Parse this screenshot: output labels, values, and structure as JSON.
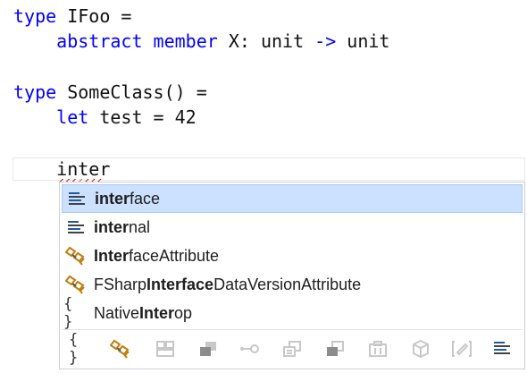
{
  "code": {
    "line1": {
      "kw": "type",
      "rest": " IFoo ="
    },
    "line2": {
      "indent": "    ",
      "kw1": "abstract",
      "sp1": " ",
      "kw2": "member",
      "mid": " X: unit ",
      "arrow": "->",
      "end": " unit"
    },
    "line4": {
      "kw": "type",
      "rest": " SomeClass() ="
    },
    "line5": {
      "indent": "    ",
      "kw": "let",
      "rest": " test = 42"
    },
    "line7": {
      "indent": "    ",
      "text": "inter"
    }
  },
  "completion": {
    "items": [
      {
        "bold": "inter",
        "rest": "face",
        "pre": "",
        "icon": "keyword-icon",
        "selected": true
      },
      {
        "bold": "inter",
        "rest": "nal",
        "pre": "",
        "icon": "keyword-icon",
        "selected": false
      },
      {
        "bold": "Inter",
        "rest": "faceAttribute",
        "pre": "",
        "icon": "class-icon",
        "selected": false
      },
      {
        "bold": "Interface",
        "rest": "DataVersionAttribute",
        "pre": "FSharp",
        "icon": "class-icon",
        "selected": false
      },
      {
        "bold": "Inter",
        "rest": "op",
        "pre": "Native",
        "icon": "namespace-icon",
        "selected": false
      }
    ],
    "filters": [
      {
        "name": "namespace-filter-icon",
        "glyph": "{ }"
      },
      {
        "name": "class-filter-icon",
        "glyph": ""
      },
      {
        "name": "structure-filter-icon",
        "glyph": ""
      },
      {
        "name": "module-filter-icon",
        "glyph": ""
      },
      {
        "name": "interface-filter-icon",
        "glyph": ""
      },
      {
        "name": "enum-filter-icon",
        "glyph": ""
      },
      {
        "name": "delegate-filter-icon",
        "glyph": ""
      },
      {
        "name": "event-filter-icon",
        "glyph": ""
      },
      {
        "name": "method-filter-icon",
        "glyph": ""
      },
      {
        "name": "property-filter-icon",
        "glyph": ""
      },
      {
        "name": "field-filter-icon",
        "glyph": ""
      },
      {
        "name": "keyword-filter-icon",
        "glyph": ""
      }
    ]
  },
  "colors": {
    "keyword": "#0000ff",
    "selection": "#cce0ff",
    "class_icon": "#c27d0e",
    "keyword_icon": "#1e5aa8"
  }
}
